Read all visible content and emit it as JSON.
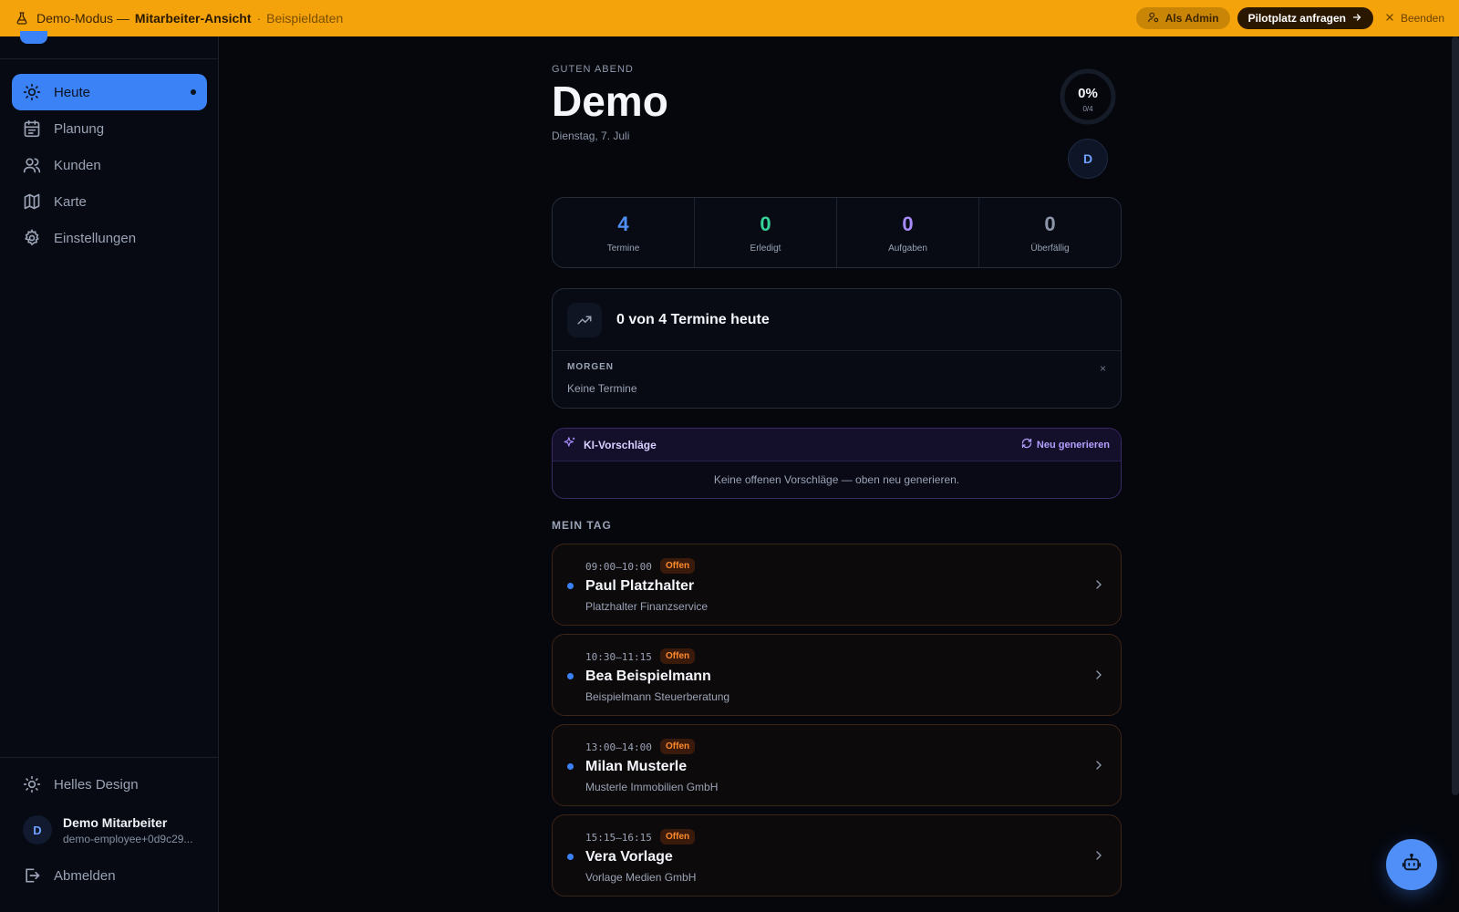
{
  "banner": {
    "mode": "Demo-Modus —",
    "view": "Mitarbeiter-Ansicht",
    "separator": "·",
    "sample": "Beispieldaten",
    "as_admin": "Als Admin",
    "pilot": "Pilotplatz anfragen",
    "end": "Beenden"
  },
  "sidebar": {
    "items": [
      {
        "label": "Heute",
        "icon": "sun-icon",
        "active": true
      },
      {
        "label": "Planung",
        "icon": "calendar-icon"
      },
      {
        "label": "Kunden",
        "icon": "users-icon"
      },
      {
        "label": "Karte",
        "icon": "map-icon"
      },
      {
        "label": "Einstellungen",
        "icon": "gear-icon"
      }
    ],
    "theme_toggle": "Helles Design",
    "user": {
      "initial": "D",
      "name": "Demo Mitarbeiter",
      "email": "demo-employee+0d9c29..."
    },
    "logout": "Abmelden"
  },
  "header": {
    "greeting": "GUTEN ABEND",
    "name": "Demo",
    "date": "Dienstag, 7. Juli",
    "progress_pct": "0%",
    "progress_frac": "0/4",
    "progress_value": 0,
    "avatar_initial": "D"
  },
  "stats": [
    {
      "value": "4",
      "label": "Termine",
      "color": "#4f8ff7"
    },
    {
      "value": "0",
      "label": "Erledigt",
      "color": "#34d399"
    },
    {
      "value": "0",
      "label": "Aufgaben",
      "color": "#a78bfa"
    },
    {
      "value": "0",
      "label": "Überfällig",
      "color": "#8e97aa"
    }
  ],
  "progress_card": {
    "title": "0 von 4 Termine heute",
    "label": "MORGEN",
    "empty": "Keine Termine",
    "close": "×"
  },
  "ai": {
    "title": "KI-Vorschläge",
    "regen": "Neu generieren",
    "empty": "Keine offenen Vorschläge — oben neu generieren."
  },
  "day": {
    "title": "MEIN TAG",
    "appointments": [
      {
        "time": "09:00–10:00",
        "status": "Offen",
        "name": "Paul Platzhalter",
        "company": "Platzhalter Finanzservice"
      },
      {
        "time": "10:30–11:15",
        "status": "Offen",
        "name": "Bea Beispielmann",
        "company": "Beispielmann Steuerberatung"
      },
      {
        "time": "13:00–14:00",
        "status": "Offen",
        "name": "Milan Musterle",
        "company": "Musterle Immobilien GmbH"
      },
      {
        "time": "15:15–16:15",
        "status": "Offen",
        "name": "Vera Vorlage",
        "company": "Vorlage Medien GmbH"
      }
    ]
  },
  "colors": {
    "accent": "#3b82f6",
    "banner": "#f5a30b",
    "status_open": "#ff8a2b"
  }
}
